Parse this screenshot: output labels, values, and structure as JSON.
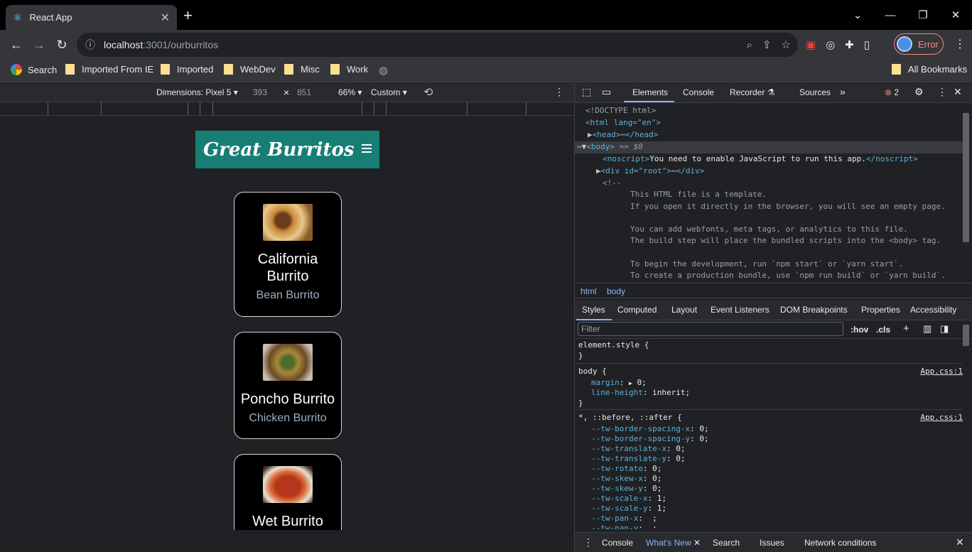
{
  "browser": {
    "tab_title": "React App",
    "tab_close": "✕",
    "new_tab": "+",
    "url_host": "localhost",
    "url_path": ":3001/ourburritos",
    "profile_label": "Error",
    "bookmarks": [
      "Search",
      "Imported From IE",
      "Imported",
      "WebDev",
      "Misc",
      "Work"
    ],
    "all_bookmarks": "All Bookmarks"
  },
  "device_toolbar": {
    "dimensions": "Dimensions: Pixel 5",
    "width": "393",
    "times": "×",
    "height": "851",
    "zoom": "66%",
    "throttle": "Custom"
  },
  "app": {
    "logo": "Great Burritos",
    "cards": [
      {
        "name": "California Burrito",
        "sub": "Bean Burrito"
      },
      {
        "name": "Poncho Burrito",
        "sub": "Chicken Burrito"
      },
      {
        "name": "Wet Burrito",
        "sub": ""
      }
    ]
  },
  "devtools": {
    "tabs": [
      "Elements",
      "Console",
      "Recorder",
      "Sources"
    ],
    "error_count": "2",
    "dom": {
      "doctype": "<!DOCTYPE html>",
      "html_open": "<html lang=\"en\">",
      "head": "<head>",
      "head_close": "</head>",
      "body": "<body>",
      "body_eq": "== $0",
      "noscript_text": "You need to enable JavaScript to run this app.",
      "div_root": "<div id=\"root\">",
      "div_close": "</div>",
      "comment_open": "<!--",
      "c1": "This HTML file is a template.",
      "c2": "If you open it directly in the browser, you will see an empty page.",
      "c3": "You can add webfonts, meta tags, or analytics to this file.",
      "c4": "The build step will place the bundled scripts into the <body> tag.",
      "c5": "To begin the development, run `npm start` or `yarn start`.",
      "c6": "To create a production bundle, use `npm run build` or `yarn build`."
    },
    "crumbs": [
      "html",
      "body"
    ],
    "subtabs": [
      "Styles",
      "Computed",
      "Layout",
      "Event Listeners",
      "DOM Breakpoints",
      "Properties",
      "Accessibility"
    ],
    "filter_placeholder": "Filter",
    "hov": ":hov",
    "cls": ".cls",
    "styles": {
      "element_style": "element.style {",
      "close": "}",
      "body_sel": "body {",
      "body_src": "App.css:1",
      "margin_prop": "margin",
      "margin_val": "0;",
      "lh_prop": "line-height",
      "lh_val": "inherit;",
      "univ_sel": "*, ::before, ::after {",
      "univ_src": "App.css:1",
      "vars": [
        [
          "--tw-border-spacing-x",
          "0;"
        ],
        [
          "--tw-border-spacing-y",
          "0;"
        ],
        [
          "--tw-translate-x",
          "0;"
        ],
        [
          "--tw-translate-y",
          "0;"
        ],
        [
          "--tw-rotate",
          "0;"
        ],
        [
          "--tw-skew-x",
          "0;"
        ],
        [
          "--tw-skew-y",
          "0;"
        ],
        [
          "--tw-scale-x",
          "1;"
        ],
        [
          "--tw-scale-y",
          "1;"
        ],
        [
          "--tw-pan-x",
          " ;"
        ],
        [
          "--tw-pan-y",
          " ;"
        ]
      ]
    },
    "drawer": [
      "Console",
      "What's New",
      "Search",
      "Issues",
      "Network conditions"
    ]
  }
}
